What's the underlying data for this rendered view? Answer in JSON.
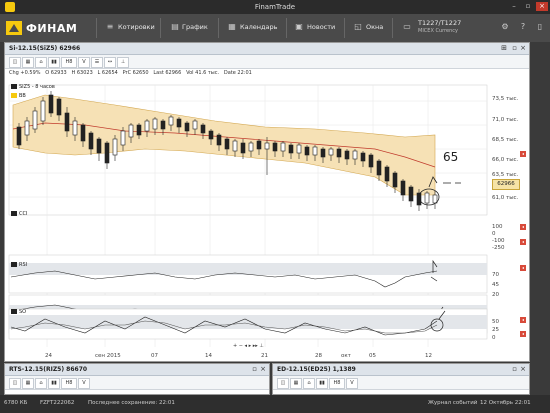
{
  "window": {
    "title": "FinamTrade"
  },
  "menubar": {
    "logo": "ФИНАМ",
    "items": [
      {
        "label": "Котировки",
        "icon": "quotes-icon"
      },
      {
        "label": "График",
        "icon": "chart-icon"
      },
      {
        "label": "Календарь",
        "icon": "calendar-icon"
      },
      {
        "label": "Новости",
        "icon": "news-icon"
      },
      {
        "label": "Окна",
        "icon": "windows-icon"
      }
    ],
    "account": {
      "id": "T1227/T1227",
      "sub": "MICEX Currency"
    }
  },
  "main_pane": {
    "title": "Si-12.15(SiZ5) 62966",
    "toolbar": [
      "◫",
      "▦",
      "⌂",
      "▮▮",
      "H8",
      "V",
      "☰",
      "↔",
      "⊥"
    ],
    "stats": {
      "chg": "Chg +0.59%",
      "o": "O 62933",
      "h": "H 63023",
      "l": "L 62654",
      "prc": "PrC 62650",
      "last": "Last 62966",
      "vol": "Vol 41.6 тыс.",
      "date": "Date 22:01"
    },
    "legend_main": "SIZ5 - 8 часов",
    "legend_bb": "BB",
    "price_axis": [
      "73,5 тыс.",
      "71,0 тыс.",
      "68,5 тыс.",
      "66,0 тыс.",
      "63,5 тыс.",
      "61,0 тыс."
    ],
    "last_price": "62966",
    "handwritten": "65",
    "indicators": [
      {
        "name": "CCI",
        "levels": [
          "100",
          "0",
          "-100",
          "-250"
        ]
      },
      {
        "name": "RSI",
        "levels": [
          "70",
          "45",
          "20"
        ]
      },
      {
        "name": "SO",
        "levels": [
          "50",
          "25",
          "0"
        ]
      }
    ],
    "x_axis": [
      "24",
      "сен 2015",
      "07",
      "14",
      "21",
      "28",
      "окт",
      "05",
      "12"
    ]
  },
  "bottom_panes": [
    {
      "title": "RTS-12.15(RIZ5) 86670"
    },
    {
      "title": "ED-12.15(ED25) 1,1389"
    }
  ],
  "statusbar": {
    "left1": "6780 КБ",
    "left2": "FZFT222062",
    "left3": "Последнее сохранение: 22:01",
    "journal": "Журнал событий",
    "datetime": "12 Октябрь 22:01"
  },
  "colors": {
    "bb_fill": "#f6e1b5",
    "bb_line": "#c97a5a",
    "candle": "#222222",
    "accent": "#d84a3a"
  }
}
